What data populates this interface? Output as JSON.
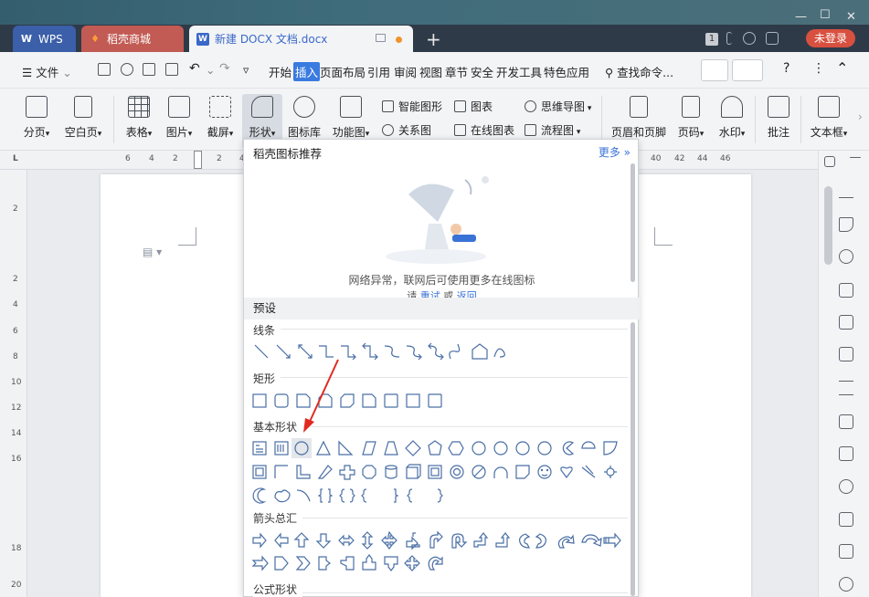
{
  "tabs": {
    "wps": "WPS",
    "daoke": "稻壳商城",
    "doc": "新建 DOCX 文档.docx",
    "login": "未登录",
    "badge": "1"
  },
  "menu": {
    "file": "文件",
    "items": [
      "开始",
      "插入",
      "页面布局",
      "引用",
      "审阅",
      "视图",
      "章节",
      "安全",
      "开发工具",
      "特色应用"
    ],
    "search": "查找命令..."
  },
  "ribbon": {
    "big": [
      "分页",
      "空白页",
      "表格",
      "图片",
      "截屏",
      "形状",
      "图标库",
      "功能图"
    ],
    "small_col1": [
      "智能图形",
      "关系图"
    ],
    "small_col2": [
      "图表",
      "在线图表"
    ],
    "small_col3": [
      "思维导图",
      "流程图"
    ],
    "right": [
      "页眉和页脚",
      "页码",
      "水印",
      "批注",
      "文本框"
    ]
  },
  "ruler": {
    "h_left": [
      "6",
      "4",
      "2",
      "2",
      "4"
    ],
    "h_right": [
      "40",
      "42",
      "44",
      "46"
    ],
    "v": [
      "2",
      "2",
      "4",
      "6",
      "8",
      "10",
      "12",
      "14",
      "16",
      "18",
      "20"
    ]
  },
  "panel": {
    "header": "稻壳图标推荐",
    "more": "更多 »",
    "message": "网络异常，联网后可使用更多在线图标",
    "message2_a": "请",
    "message2_link1": "重试",
    "message2_b": "或",
    "message2_link2": "返回",
    "preset": "预设",
    "sections": [
      "线条",
      "矩形",
      "基本形状",
      "箭头总汇",
      "公式形状"
    ]
  },
  "colors": {
    "accent": "#3a7be0",
    "login": "#d8503f",
    "arrow": "#e02a20"
  }
}
